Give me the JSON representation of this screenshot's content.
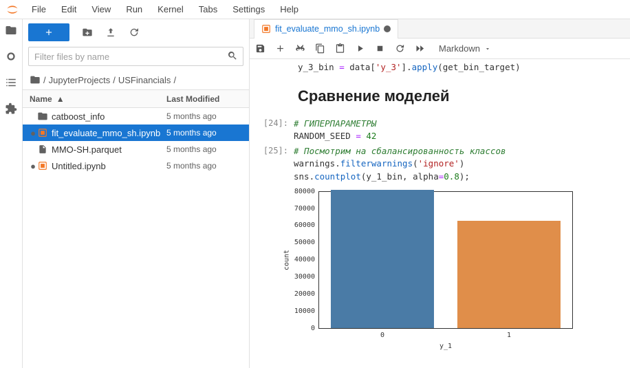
{
  "menu": {
    "items": [
      "File",
      "Edit",
      "View",
      "Run",
      "Kernel",
      "Tabs",
      "Settings",
      "Help"
    ]
  },
  "left_rail": {
    "icons": [
      "folder-icon",
      "running-icon",
      "toc-icon",
      "extensions-icon"
    ]
  },
  "file_browser": {
    "filter_placeholder": "Filter files by name",
    "breadcrumb": [
      "JupyterProjects",
      "USFinancials"
    ],
    "columns": {
      "name": "Name",
      "modified": "Last Modified"
    },
    "files": [
      {
        "name": "catboost_info",
        "type": "folder",
        "modified": "5 months ago",
        "running": false,
        "selected": false
      },
      {
        "name": "fit_evaluate_mmo_sh.ipynb",
        "type": "notebook",
        "modified": "5 months ago",
        "running": true,
        "selected": true
      },
      {
        "name": "MMO-SH.parquet",
        "type": "file",
        "modified": "5 months ago",
        "running": false,
        "selected": false
      },
      {
        "name": "Untitled.ipynb",
        "type": "notebook",
        "modified": "5 months ago",
        "running": true,
        "selected": false
      }
    ]
  },
  "notebook": {
    "tab_title": "fit_evaluate_mmo_sh.ipynb",
    "dirty": true,
    "cell_type": "Markdown",
    "top_code": "y_3_bin = data['y_3'].apply(get_bin_target)",
    "heading": "Сравнение моделей",
    "cells": [
      {
        "prompt": "[24]:",
        "lines": [
          {
            "t": "comment",
            "v": "# ГИПЕРПАРАМЕТРЫ"
          },
          {
            "t": "assign",
            "v": "RANDOM_SEED = 42"
          }
        ]
      },
      {
        "prompt": "[25]:",
        "lines": [
          {
            "t": "comment",
            "v": "# Посмотрим на сбалансированность классов"
          },
          {
            "t": "code",
            "v": "warnings.filterwarnings('ignore')"
          },
          {
            "t": "code2",
            "v": "sns.countplot(y_1_bin, alpha=0.8);"
          }
        ]
      }
    ]
  },
  "chart_data": {
    "type": "bar",
    "categories": [
      "0",
      "1"
    ],
    "values": [
      81000,
      63000
    ],
    "xlabel": "y_1",
    "ylabel": "count",
    "ylim": [
      0,
      80000
    ],
    "yticks": [
      80000,
      70000,
      60000,
      50000,
      40000,
      30000,
      20000,
      10000,
      0
    ],
    "colors": [
      "#4a7ba6",
      "#e08e4a"
    ]
  }
}
